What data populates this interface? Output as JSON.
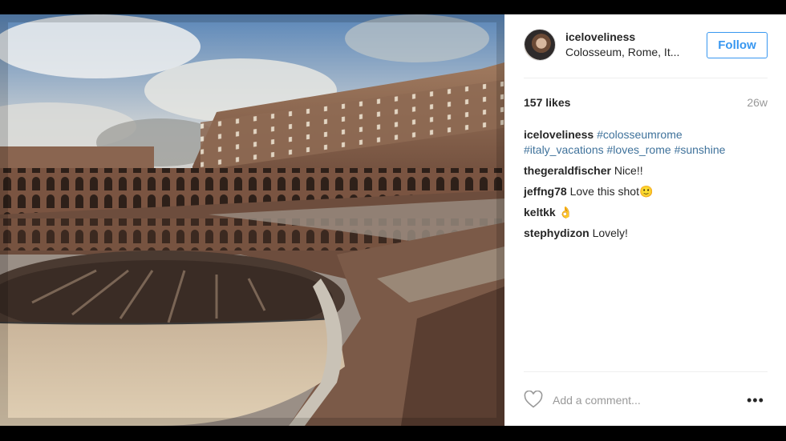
{
  "post": {
    "username": "iceloveliness",
    "location": "Colosseum, Rome, It...",
    "follow_label": "Follow",
    "likes": "157 likes",
    "time_ago": "26w",
    "caption": {
      "username": "iceloveliness",
      "tags": [
        "#colosseumrome",
        "#italy_vacations",
        "#loves_rome",
        "#sunshine"
      ]
    },
    "comments": [
      {
        "user": "thegeraldfischer",
        "text": "Nice!!"
      },
      {
        "user": "jeffng78",
        "text": "Love this shot🙂"
      },
      {
        "user": "keltkk",
        "text": "👌"
      },
      {
        "user": "stephydizon",
        "text": "Lovely!"
      }
    ],
    "add_comment_placeholder": "Add a comment...",
    "more_label": "•••"
  },
  "icons": {
    "like": "heart-outline-icon",
    "more": "more-options-icon"
  },
  "colors": {
    "follow_blue": "#3897f0",
    "hashtag": "#3f729b"
  }
}
